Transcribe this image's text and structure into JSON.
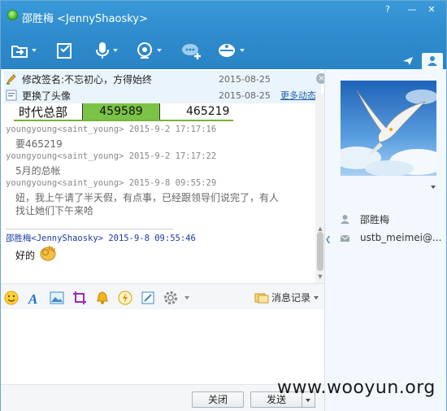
{
  "window": {
    "title": "邵胜梅 <JennyShaosky>",
    "controls": [
      "?",
      "—",
      "□",
      "✕"
    ]
  },
  "toolbar": {
    "items": [
      "file-transfer-icon",
      "edit-icon",
      "microphone-icon",
      "webcam-icon",
      "add-chat-icon",
      "remote-assist-icon"
    ],
    "right_tabs": [
      "share-icon",
      "contact-icon"
    ]
  },
  "news": [
    {
      "icon": "signature-icon",
      "text": "修改签名:不忘初心，方得始终",
      "date": "2015-08-25"
    },
    {
      "icon": "avatar-change-icon",
      "text": "更换了头像",
      "date": "2015-08-25",
      "more": "更多动态"
    }
  ],
  "embedded_table": {
    "label": "时代总部",
    "value1": "459589",
    "value2": "465219"
  },
  "messages": [
    {
      "sender": "youngyoung<saint_young>",
      "time": "2015-9-2 17:17:16",
      "text": "要465219"
    },
    {
      "sender": "youngyoung<saint_young>",
      "time": "2015-9-2 17:17:22",
      "text": "5月的总帐"
    },
    {
      "sender": "youngyoung<saint_young>",
      "time": "2015-9-8 09:55:29",
      "text": "妞，我上午请了半天假，有点事，已经跟领导们说完了，有人",
      "text2": "找让她们下午来哈"
    },
    {
      "sender": "邵胜梅<JennyShaosky>",
      "time": "2015-9-8 09:55:46",
      "text": "好的",
      "me": true
    }
  ],
  "input_toolbar": {
    "icons": [
      "emoji-icon",
      "font-icon",
      "image-icon",
      "screenshot-icon",
      "shake-icon",
      "flash-icon",
      "note-icon",
      "settings-icon"
    ],
    "history_label": "消息记录"
  },
  "buttons": {
    "close": "关闭",
    "send": "发送"
  },
  "contact": {
    "name": "邵胜梅",
    "email": "ustb_meimei@..."
  },
  "watermark": "www.wooyun.org"
}
